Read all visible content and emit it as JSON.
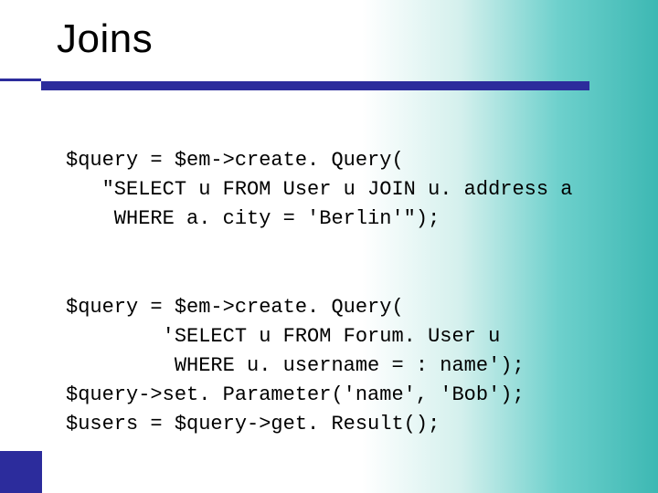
{
  "slide": {
    "title": "Joins"
  },
  "code": {
    "block1": {
      "l1": "$query = $em->create. Query(",
      "l2": "   \"SELECT u FROM User u JOIN u. address a",
      "l3": "    WHERE a. city = 'Berlin'\");"
    },
    "block2": {
      "l1": "$query = $em->create. Query(",
      "l2": "        'SELECT u FROM Forum. User u",
      "l3": "         WHERE u. username = : name');",
      "l4": "$query->set. Parameter('name', 'Bob');",
      "l5": "$users = $query->get. Result();"
    }
  }
}
